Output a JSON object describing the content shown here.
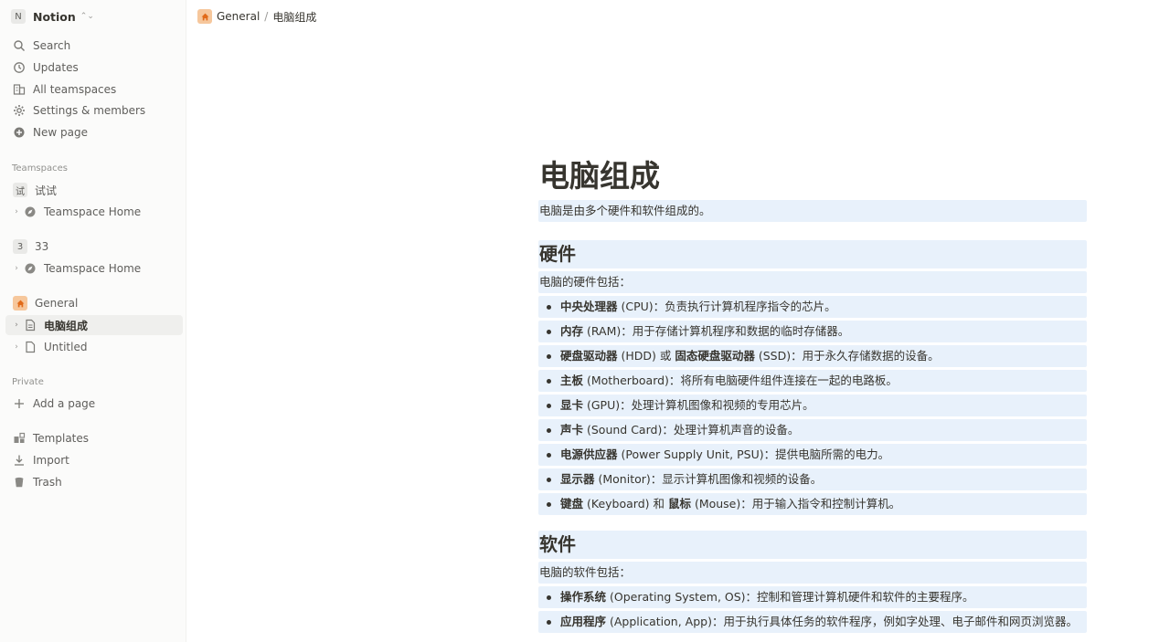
{
  "workspace": {
    "badge": "N",
    "name": "Notion"
  },
  "nav": {
    "search": "Search",
    "updates": "Updates",
    "teamspaces_all": "All teamspaces",
    "settings": "Settings & members",
    "new_page": "New page"
  },
  "teamspaces": {
    "label": "Teamspaces",
    "t1": {
      "badge": "试",
      "name": "试试",
      "home": "Teamspace Home"
    },
    "t2": {
      "badge": "3",
      "name": "33",
      "home": "Teamspace Home"
    },
    "general": {
      "name": "General",
      "page_current": "电脑组成",
      "page_untitled": "Untitled"
    }
  },
  "private": {
    "label": "Private",
    "add_page": "Add a page"
  },
  "footer": {
    "templates": "Templates",
    "import": "Import",
    "trash": "Trash"
  },
  "breadcrumb": {
    "parent": "General",
    "sep": "/",
    "current": "电脑组成"
  },
  "doc": {
    "title": "电脑组成",
    "intro": "电脑是由多个硬件和软件组成的。",
    "hardware": {
      "heading": "硬件",
      "lead": "电脑的硬件包括：",
      "items": [
        {
          "b1": "中央处理器",
          "t1": " (CPU)：负责执行计算机程序指令的芯片。"
        },
        {
          "b1": "内存",
          "t1": " (RAM)：用于存储计算机程序和数据的临时存储器。"
        },
        {
          "b1": "硬盘驱动器",
          "t1": " (HDD) 或 ",
          "b2": "固态硬盘驱动器",
          "t2": " (SSD)：用于永久存储数据的设备。"
        },
        {
          "b1": "主板",
          "t1": " (Motherboard)：将所有电脑硬件组件连接在一起的电路板。"
        },
        {
          "b1": "显卡",
          "t1": " (GPU)：处理计算机图像和视频的专用芯片。"
        },
        {
          "b1": "声卡",
          "t1": " (Sound Card)：处理计算机声音的设备。"
        },
        {
          "b1": "电源供应器",
          "t1": " (Power Supply Unit, PSU)：提供电脑所需的电力。"
        },
        {
          "b1": "显示器",
          "t1": " (Monitor)：显示计算机图像和视频的设备。"
        },
        {
          "b1": "键盘",
          "t1": " (Keyboard) 和 ",
          "b2": "鼠标",
          "t2": " (Mouse)：用于输入指令和控制计算机。"
        }
      ]
    },
    "software": {
      "heading": "软件",
      "lead": "电脑的软件包括：",
      "items": [
        {
          "b1": "操作系统",
          "t1": " (Operating System, OS)：控制和管理计算机硬件和软件的主要程序。"
        },
        {
          "b1": "应用程序",
          "t1": " (Application, App)：用于执行具体任务的软件程序，例如字处理、电子邮件和网页浏览器。"
        }
      ]
    }
  }
}
